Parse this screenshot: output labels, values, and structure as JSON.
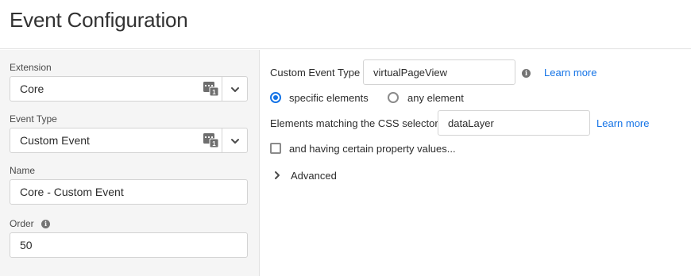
{
  "header": {
    "title": "Event Configuration"
  },
  "sidebar": {
    "extension": {
      "label": "Extension",
      "value": "Core",
      "icon": "extension-catalog-icon"
    },
    "event_type": {
      "label": "Event Type",
      "value": "Custom Event",
      "icon": "extension-catalog-icon"
    },
    "name": {
      "label": "Name",
      "value": "Core - Custom Event"
    },
    "order": {
      "label": "Order",
      "value": "50",
      "info_icon": "info-icon"
    }
  },
  "main": {
    "custom_event_type": {
      "label": "Custom Event Type",
      "value": "virtualPageView",
      "learn_more": "Learn more"
    },
    "radios": [
      {
        "label": "specific elements",
        "selected": true
      },
      {
        "label": "any element",
        "selected": false
      }
    ],
    "css_selector": {
      "label": "Elements matching the CSS selector",
      "value": "dataLayer",
      "learn_more": "Learn more"
    },
    "property_values": {
      "label": "and having certain property values...",
      "checked": false
    },
    "advanced": {
      "label": "Advanced",
      "expanded": false
    }
  },
  "colors": {
    "link": "#1473e6",
    "sidebar_bg": "#f5f5f5",
    "border": "#d3d3d3"
  }
}
